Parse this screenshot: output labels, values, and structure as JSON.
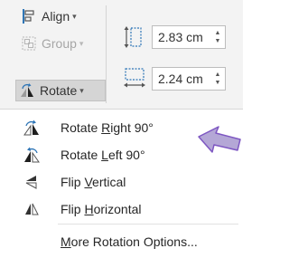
{
  "ribbon": {
    "align_label": "Align",
    "group_label": "Group",
    "rotate_label": "Rotate",
    "height_value": "2.83 cm",
    "width_value": "2.24 cm"
  },
  "rotate_menu": {
    "items": [
      {
        "prefix": "Rotate ",
        "accel": "R",
        "suffix": "ight 90°",
        "icon": "rotate-right-icon"
      },
      {
        "prefix": "Rotate ",
        "accel": "L",
        "suffix": "eft 90°",
        "icon": "rotate-left-icon"
      },
      {
        "prefix": "Flip ",
        "accel": "V",
        "suffix": "ertical",
        "icon": "flip-vertical-icon"
      },
      {
        "prefix": "Flip ",
        "accel": "H",
        "suffix": "orizontal",
        "icon": "flip-horizontal-icon"
      }
    ],
    "more": {
      "prefix": "",
      "accel": "M",
      "suffix": "ore Rotation Options..."
    }
  },
  "colors": {
    "ribbon_bg": "#f3f3f3",
    "icon_blue": "#2e75b6",
    "icon_dark": "#444444",
    "annotation_purple": "#b4a7d6",
    "annotation_outline": "#7e57c2"
  }
}
